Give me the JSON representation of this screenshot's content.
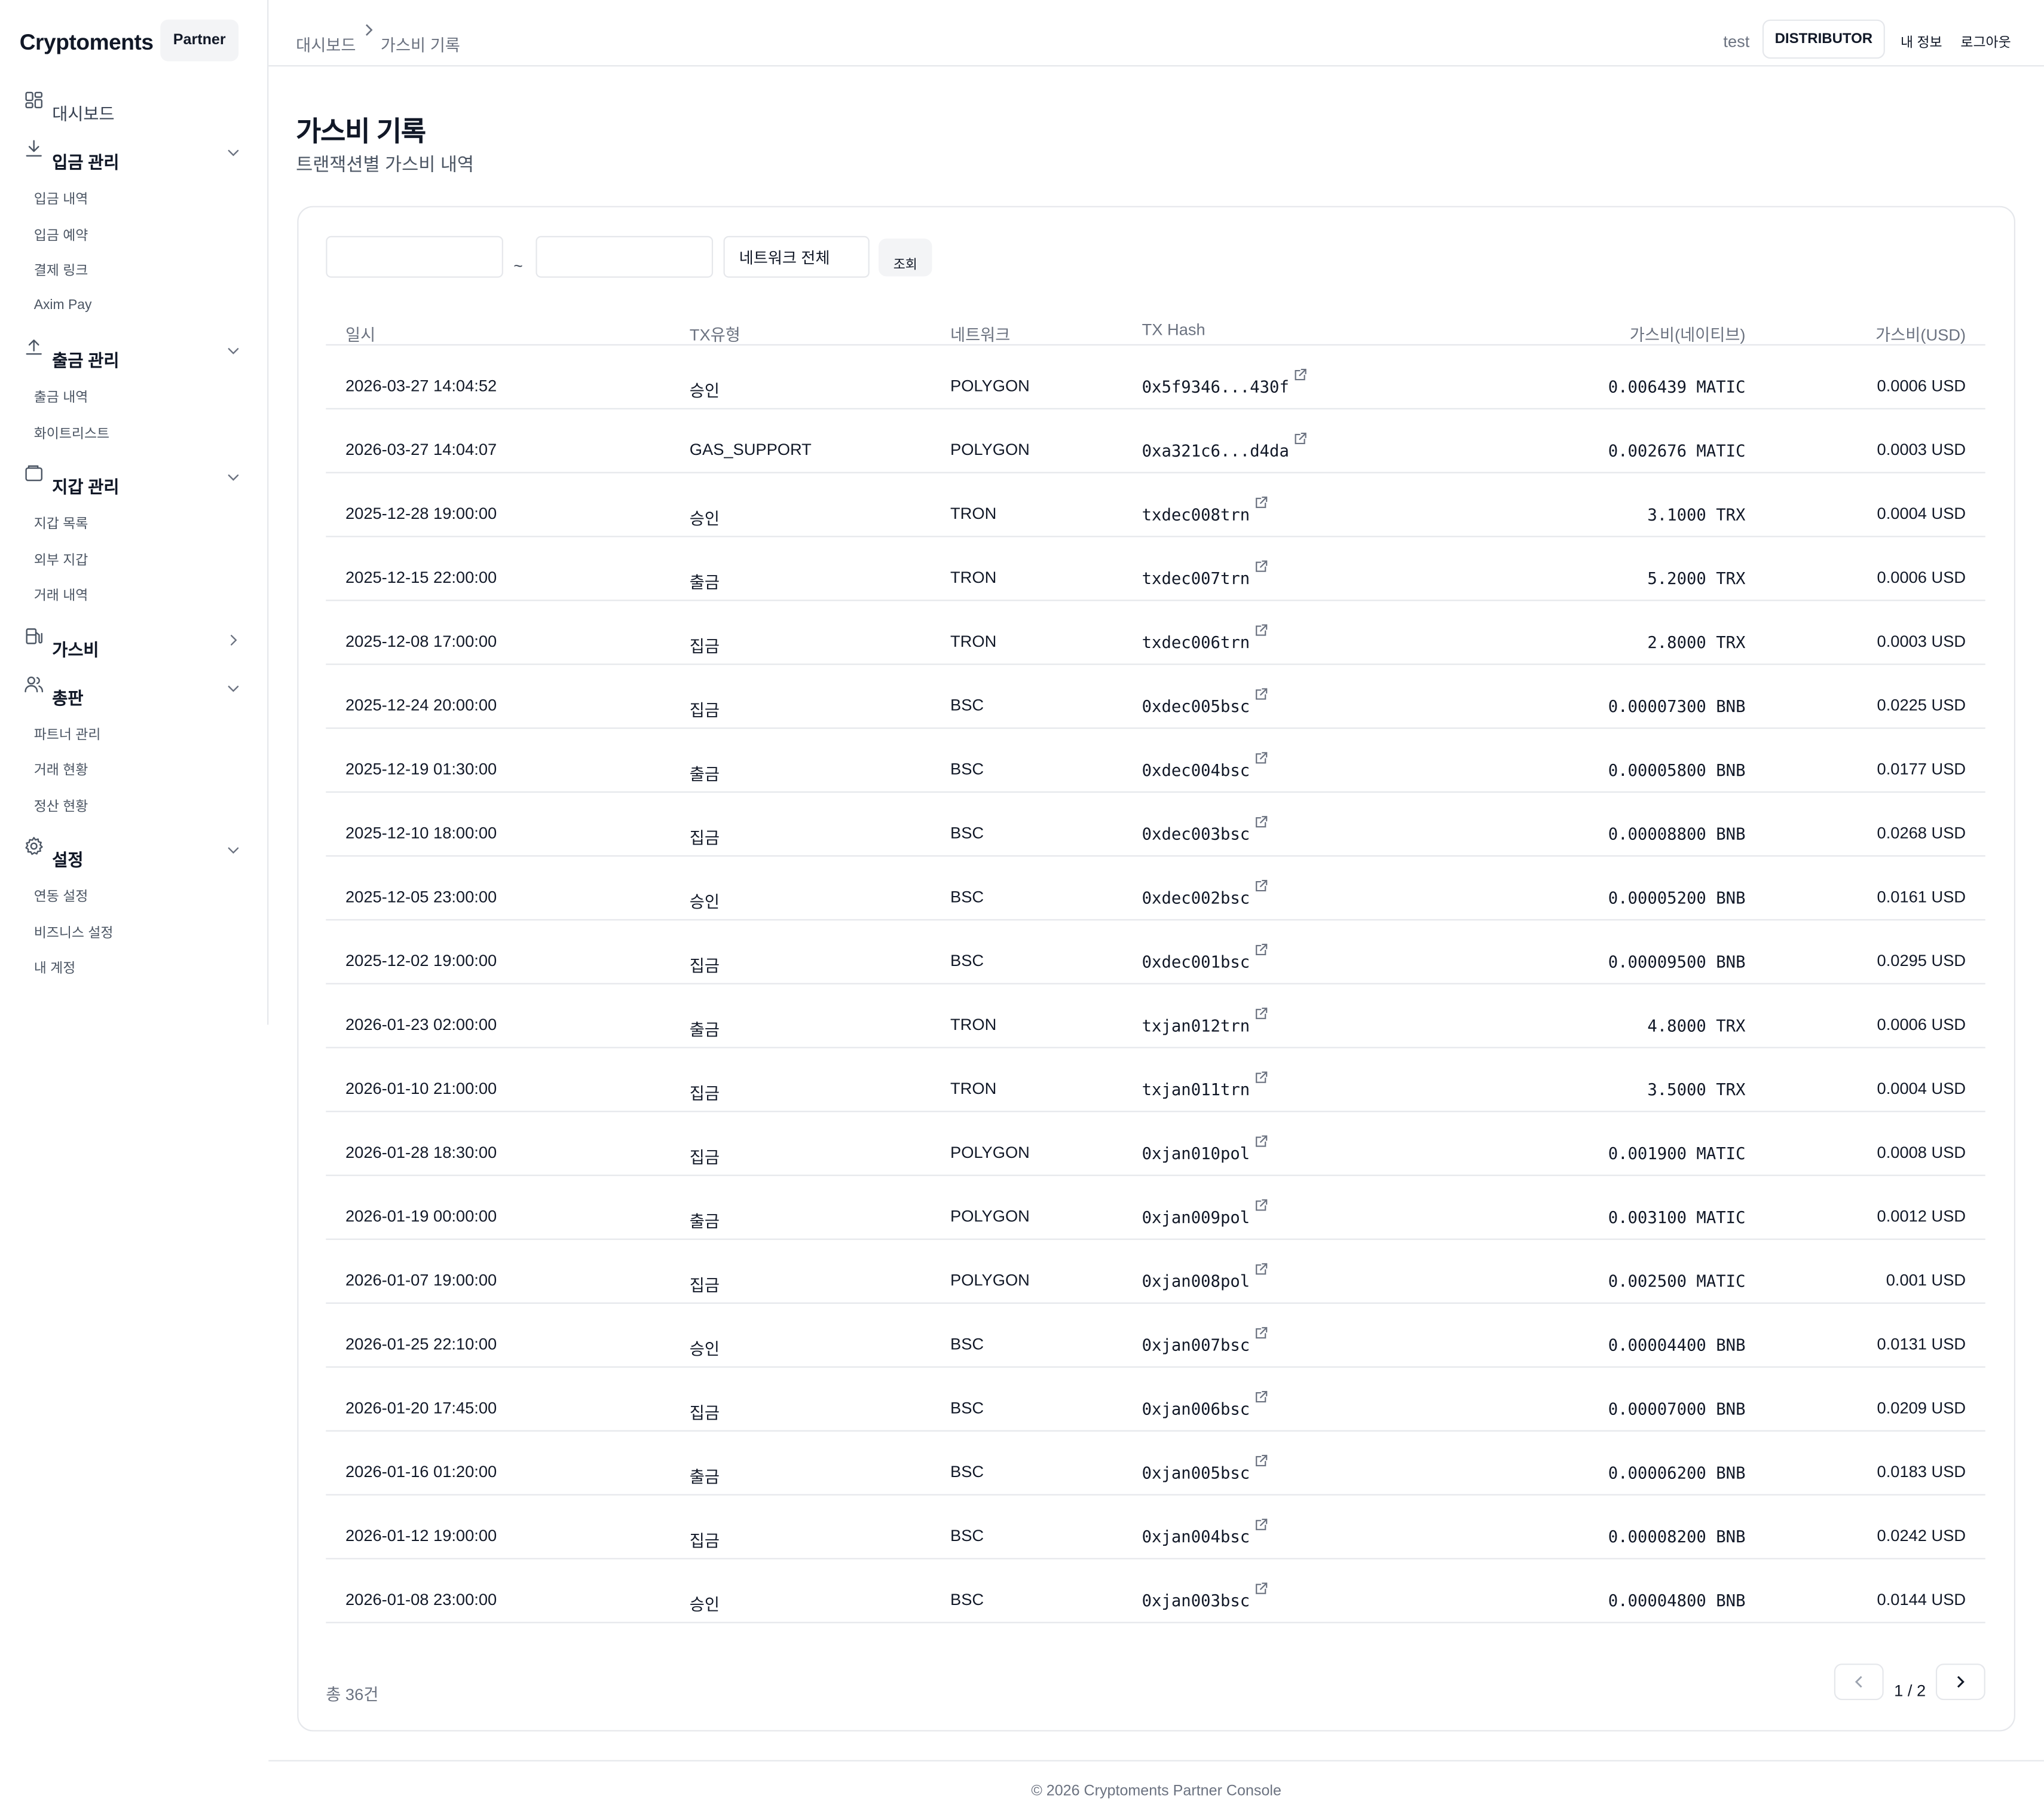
{
  "brand": {
    "name": "Cryptoments",
    "badge": "Partner"
  },
  "sidebar": {
    "groups": [
      {
        "label": "대시보드",
        "icon": "dashboard-grid-icon",
        "items": []
      },
      {
        "label": "입금 관리",
        "icon": "download-icon",
        "expanded": true,
        "items": [
          "입금 내역",
          "입금 예약",
          "결제 링크",
          "Axim Pay"
        ]
      },
      {
        "label": "출금 관리",
        "icon": "upload-icon",
        "expanded": true,
        "items": [
          "출금 내역",
          "화이트리스트"
        ]
      },
      {
        "label": "지갑 관리",
        "icon": "wallet-icon",
        "expanded": true,
        "items": [
          "지갑 목록",
          "외부 지갑",
          "거래 내역"
        ]
      },
      {
        "label": "가스비",
        "icon": "fuel-pump-icon",
        "expanded": false,
        "items": []
      },
      {
        "label": "총판",
        "icon": "users-icon",
        "expanded": true,
        "items": [
          "파트너 관리",
          "거래 현황",
          "정산 현황"
        ]
      },
      {
        "label": "설정",
        "icon": "gear-icon",
        "expanded": true,
        "items": [
          "연동 설정",
          "비즈니스 설정",
          "내 계정"
        ]
      }
    ]
  },
  "header": {
    "breadcrumb": [
      "대시보드",
      "가스비 기록"
    ],
    "user": "test",
    "role": "DISTRIBUTOR",
    "my_info": "내 정보",
    "logout": "로그아웃"
  },
  "page": {
    "title": "가스비 기록",
    "subtitle": "트랜잭션별 가스비 내역"
  },
  "filters": {
    "start_date": "",
    "end_date": "",
    "separator": "~",
    "network": "네트워크 전체",
    "search_label": "조회"
  },
  "table": {
    "columns": [
      "일시",
      "TX유형",
      "네트워크",
      "TX Hash",
      "가스비(네이티브)",
      "가스비(USD)"
    ],
    "rows": [
      [
        "2026-03-27 14:04:52",
        "승인",
        "POLYGON",
        "0x5f9346...430f",
        "0.006439 MATIC",
        "0.0006 USD"
      ],
      [
        "2026-03-27 14:04:07",
        "GAS_SUPPORT",
        "POLYGON",
        "0xa321c6...d4da",
        "0.002676 MATIC",
        "0.0003 USD"
      ],
      [
        "2025-12-28 19:00:00",
        "승인",
        "TRON",
        "txdec008trn",
        "3.1000 TRX",
        "0.0004 USD"
      ],
      [
        "2025-12-15 22:00:00",
        "출금",
        "TRON",
        "txdec007trn",
        "5.2000 TRX",
        "0.0006 USD"
      ],
      [
        "2025-12-08 17:00:00",
        "집금",
        "TRON",
        "txdec006trn",
        "2.8000 TRX",
        "0.0003 USD"
      ],
      [
        "2025-12-24 20:00:00",
        "집금",
        "BSC",
        "0xdec005bsc",
        "0.00007300 BNB",
        "0.0225 USD"
      ],
      [
        "2025-12-19 01:30:00",
        "출금",
        "BSC",
        "0xdec004bsc",
        "0.00005800 BNB",
        "0.0177 USD"
      ],
      [
        "2025-12-10 18:00:00",
        "집금",
        "BSC",
        "0xdec003bsc",
        "0.00008800 BNB",
        "0.0268 USD"
      ],
      [
        "2025-12-05 23:00:00",
        "승인",
        "BSC",
        "0xdec002bsc",
        "0.00005200 BNB",
        "0.0161 USD"
      ],
      [
        "2025-12-02 19:00:00",
        "집금",
        "BSC",
        "0xdec001bsc",
        "0.00009500 BNB",
        "0.0295 USD"
      ],
      [
        "2026-01-23 02:00:00",
        "출금",
        "TRON",
        "txjan012trn",
        "4.8000 TRX",
        "0.0006 USD"
      ],
      [
        "2026-01-10 21:00:00",
        "집금",
        "TRON",
        "txjan011trn",
        "3.5000 TRX",
        "0.0004 USD"
      ],
      [
        "2026-01-28 18:30:00",
        "집금",
        "POLYGON",
        "0xjan010pol",
        "0.001900 MATIC",
        "0.0008 USD"
      ],
      [
        "2026-01-19 00:00:00",
        "출금",
        "POLYGON",
        "0xjan009pol",
        "0.003100 MATIC",
        "0.0012 USD"
      ],
      [
        "2026-01-07 19:00:00",
        "집금",
        "POLYGON",
        "0xjan008pol",
        "0.002500 MATIC",
        "0.001 USD"
      ],
      [
        "2026-01-25 22:10:00",
        "승인",
        "BSC",
        "0xjan007bsc",
        "0.00004400 BNB",
        "0.0131 USD"
      ],
      [
        "2026-01-20 17:45:00",
        "집금",
        "BSC",
        "0xjan006bsc",
        "0.00007000 BNB",
        "0.0209 USD"
      ],
      [
        "2026-01-16 01:20:00",
        "출금",
        "BSC",
        "0xjan005bsc",
        "0.00006200 BNB",
        "0.0183 USD"
      ],
      [
        "2026-01-12 19:00:00",
        "집금",
        "BSC",
        "0xjan004bsc",
        "0.00008200 BNB",
        "0.0242 USD"
      ],
      [
        "2026-01-08 23:00:00",
        "승인",
        "BSC",
        "0xjan003bsc",
        "0.00004800 BNB",
        "0.0144 USD"
      ]
    ]
  },
  "pagination": {
    "total": "총 36건",
    "page_info": "1 / 2"
  },
  "footer": "© 2026 Cryptoments Partner Console"
}
